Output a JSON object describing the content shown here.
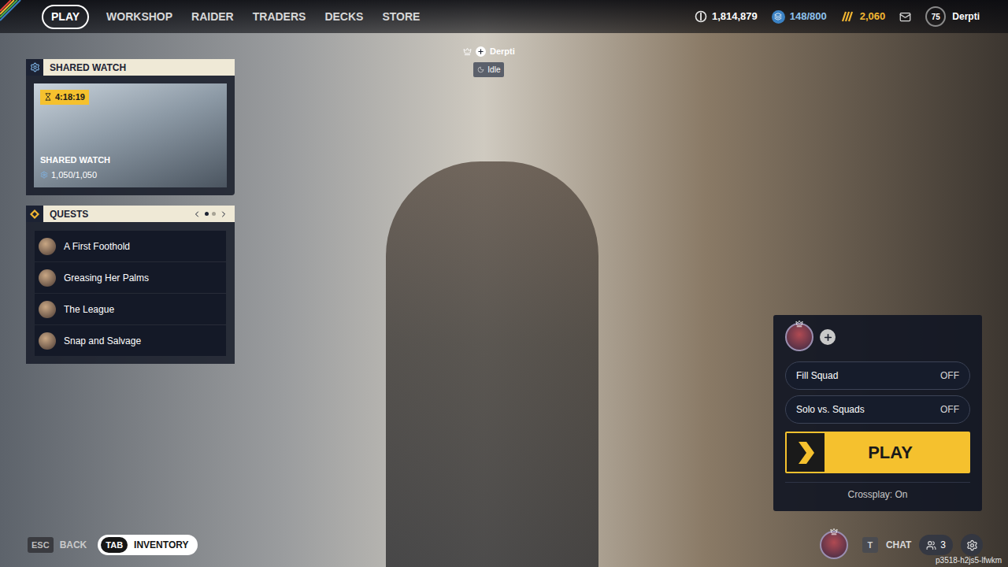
{
  "top_nav": {
    "items": [
      {
        "label": "PLAY",
        "selected": true
      },
      {
        "label": "WORKSHOP",
        "selected": false
      },
      {
        "label": "RAIDER",
        "selected": false
      },
      {
        "label": "TRADERS",
        "selected": false
      },
      {
        "label": "DECKS",
        "selected": false
      },
      {
        "label": "STORE",
        "selected": false
      }
    ],
    "currencies": [
      {
        "value": "1,814,879",
        "kind": "coins"
      },
      {
        "value": "148/800",
        "kind": "capacity"
      },
      {
        "value": "2,060",
        "kind": "tokens"
      }
    ],
    "level": "75",
    "username": "Derpti"
  },
  "shared_watch": {
    "title": "SHARED WATCH",
    "timer": "4:18:19",
    "card_title": "SHARED WATCH",
    "progress": "1,050/1,050"
  },
  "quests": {
    "title": "QUESTS",
    "pages": [
      {
        "selected": true
      },
      {
        "selected": false
      }
    ],
    "items": [
      {
        "name": "A First Foothold"
      },
      {
        "name": "Greasing Her Palms"
      },
      {
        "name": "The League"
      },
      {
        "name": "Snap and Salvage"
      }
    ]
  },
  "player_tag": {
    "name": "Derpti",
    "status": "Idle"
  },
  "squad": {
    "toggles": [
      {
        "label": "Fill Squad",
        "value": "OFF",
        "on": false
      },
      {
        "label": "Solo vs. Squads",
        "value": "OFF",
        "on": false
      }
    ],
    "play_button": "PLAY",
    "crossplay": "Crossplay: On"
  },
  "bottom_bar": {
    "back": {
      "key": "ESC",
      "label": "BACK"
    },
    "inventory": {
      "key": "TAB",
      "label": "INVENTORY"
    },
    "chat": {
      "key": "T",
      "label": "CHAT"
    },
    "friends_count": "3",
    "session_id": "p3518-h2js5-lfwkm"
  }
}
